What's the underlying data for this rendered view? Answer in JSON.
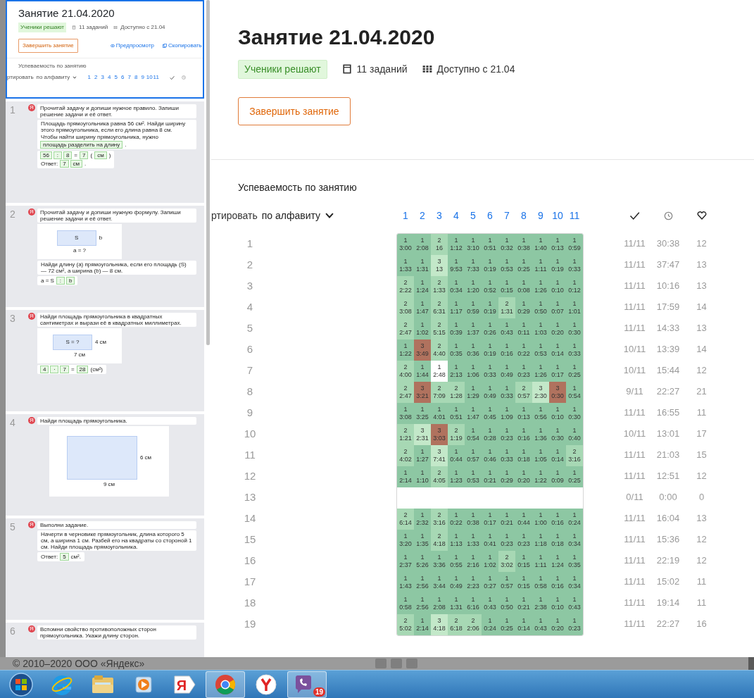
{
  "sidebar": {
    "preview": {
      "selected": true,
      "title": "Занятие 21.04.2020",
      "status": "Ученики решают",
      "tasks": "11 заданий",
      "available": "Доступно с 21.04",
      "finish_button": "Завершить занятие",
      "preview_link": "Предпросмотр",
      "copy_link": "Скопировать",
      "section": "Успеваемость по занятию",
      "sort_label": "ртировать",
      "sort_value": "по алфавиту",
      "columns": [
        "1",
        "2",
        "3",
        "4",
        "5",
        "6",
        "7",
        "8",
        "9",
        "10",
        "11"
      ]
    },
    "slides": [
      {
        "number": "1",
        "items": [
          {
            "kind": "instruction",
            "mark": "Я",
            "text": "Прочитай задачу и допиши нужное правило. Запиши решение задачи и её ответ."
          },
          {
            "kind": "card",
            "lines": [
              [
                {
                  "kind": "label",
                  "text": "Площадь прямоугольника равна 56 см². Найди ширину этого прямоугольника, если его длина равна 8 см."
                }
              ],
              [
                {
                  "kind": "label",
                  "text": "Чтобы найти ширину прямоугольника, нужно"
                }
              ],
              [
                {
                  "kind": "input",
                  "text": "площадь разделить на длину"
                },
                {
                  "kind": "label",
                  "text": "."
                }
              ]
            ]
          },
          {
            "kind": "card",
            "lines": [
              [
                {
                  "kind": "input",
                  "text": "56"
                },
                {
                  "kind": "input",
                  "text": ":"
                },
                {
                  "kind": "input",
                  "text": "8"
                },
                {
                  "kind": "label",
                  "text": "="
                },
                {
                  "kind": "input",
                  "text": "7"
                },
                {
                  "kind": "label",
                  "text": "("
                },
                {
                  "kind": "input",
                  "text": "см"
                },
                {
                  "kind": "label",
                  "text": ")"
                }
              ],
              [
                {
                  "kind": "label",
                  "text": "Ответ:"
                },
                {
                  "kind": "input",
                  "text": "7"
                },
                {
                  "kind": "input",
                  "text": "см"
                },
                {
                  "kind": "label",
                  "text": "."
                }
              ]
            ]
          }
        ]
      },
      {
        "number": "2",
        "items": [
          {
            "kind": "instruction",
            "mark": "Я",
            "text": "Прочитай задачу и допиши нужную формулу. Запиши решение задачи и её ответ."
          },
          {
            "kind": "figure",
            "inside": "S",
            "side": "b",
            "bottom": "a = ?"
          },
          {
            "kind": "card",
            "lines": [
              [
                {
                  "kind": "label",
                  "text": "Найди длину (a) прямоугольника, если его площадь (S) — 72 см², а ширина (b) — 8 см."
                }
              ]
            ]
          },
          {
            "kind": "card",
            "lines": [
              [
                {
                  "kind": "label",
                  "text": "a = S"
                },
                {
                  "kind": "input",
                  "text": ":"
                },
                {
                  "kind": "input",
                  "text": "b"
                }
              ]
            ]
          }
        ]
      },
      {
        "number": "3",
        "items": [
          {
            "kind": "instruction",
            "mark": "Я",
            "text": "Найди площадь прямоугольника в квадратных сантиметрах и вырази её в квадратных миллиметрах."
          },
          {
            "kind": "figure",
            "inside": "S = ?",
            "side": "4 см",
            "bottom": "7 см"
          },
          {
            "kind": "card",
            "lines": [
              [
                {
                  "kind": "input",
                  "text": "4"
                },
                {
                  "kind": "input",
                  "text": "·"
                },
                {
                  "kind": "input",
                  "text": "7"
                },
                {
                  "kind": "label",
                  "text": "="
                },
                {
                  "kind": "input",
                  "text": "28"
                },
                {
                  "kind": "label",
                  "text": "(см²)"
                }
              ]
            ]
          }
        ]
      },
      {
        "number": "4",
        "items": [
          {
            "kind": "instruction",
            "mark": "Я",
            "text": "Найди площадь прямоугольника."
          },
          {
            "kind": "figure-large",
            "side": "6 см",
            "bottom": "9 см"
          }
        ]
      },
      {
        "number": "5",
        "items": [
          {
            "kind": "instruction",
            "mark": "Я",
            "text": "Выполни задание."
          },
          {
            "kind": "card",
            "lines": [
              [
                {
                  "kind": "label",
                  "text": "Начерти в черновике прямоугольник, длина которого 5 см, а ширина 1 см. Разбей его на квадраты со стороной 1 см. Найди площадь прямоугольника."
                }
              ]
            ]
          },
          {
            "kind": "card",
            "lines": [
              [
                {
                  "kind": "label",
                  "text": "Ответ:"
                },
                {
                  "kind": "input",
                  "text": "5"
                },
                {
                  "kind": "label",
                  "text": "см²."
                }
              ]
            ]
          }
        ]
      },
      {
        "number": "6",
        "items": [
          {
            "kind": "instruction",
            "mark": "Я",
            "text": "Вспомни свойство противоположных сторон прямоугольника. Укажи длину сторон."
          }
        ]
      }
    ]
  },
  "lesson": {
    "title": "Занятие 21.04.2020",
    "status": "Ученики решают",
    "tasks": "11 заданий",
    "available": "Доступно с 21.04",
    "finish_button": "Завершить занятие"
  },
  "progress": {
    "title": "Успеваемость по занятию",
    "sort_label": "ртировать",
    "sort_value": "по алфавиту",
    "columns": [
      "1",
      "2",
      "3",
      "4",
      "5",
      "6",
      "7",
      "8",
      "9",
      "10",
      "11"
    ],
    "rows": [
      {
        "number": "1",
        "cells": [
          {
            "tries": "1",
            "time": "3:00",
            "kind": "g1"
          },
          {
            "tries": "1",
            "time": "2:08",
            "kind": "g1"
          },
          {
            "tries": "2",
            "time": "16",
            "kind": "g2"
          },
          {
            "tries": "1",
            "time": "1:12",
            "kind": "g1"
          },
          {
            "tries": "1",
            "time": "3:10",
            "kind": "g1"
          },
          {
            "tries": "1",
            "time": "0:51",
            "kind": "g1"
          },
          {
            "tries": "1",
            "time": "0:32",
            "kind": "g1"
          },
          {
            "tries": "1",
            "time": "0:38",
            "kind": "g1"
          },
          {
            "tries": "1",
            "time": "1:40",
            "kind": "g1"
          },
          {
            "tries": "1",
            "time": "0:13",
            "kind": "g1"
          },
          {
            "tries": "1",
            "time": "0:59",
            "kind": "g1"
          }
        ],
        "solved": "11/11",
        "time": "30:38",
        "score": "12"
      },
      {
        "number": "2",
        "cells": [
          {
            "tries": "1",
            "time": "1:33",
            "kind": "g1"
          },
          {
            "tries": "1",
            "time": "1:31",
            "kind": "g1"
          },
          {
            "tries": "3",
            "time": "13",
            "kind": "g3"
          },
          {
            "tries": "1",
            "time": "9:53",
            "kind": "g1"
          },
          {
            "tries": "1",
            "time": "7:33",
            "kind": "g1"
          },
          {
            "tries": "1",
            "time": "0:19",
            "kind": "g1"
          },
          {
            "tries": "1",
            "time": "0:53",
            "kind": "g1"
          },
          {
            "tries": "1",
            "time": "0:25",
            "kind": "g1"
          },
          {
            "tries": "1",
            "time": "1:11",
            "kind": "g1"
          },
          {
            "tries": "1",
            "time": "0:19",
            "kind": "g1"
          },
          {
            "tries": "1",
            "time": "0:33",
            "kind": "g1"
          }
        ],
        "solved": "11/11",
        "time": "37:47",
        "score": "13"
      },
      {
        "number": "3",
        "cells": [
          {
            "tries": "2",
            "time": "2:22",
            "kind": "g2"
          },
          {
            "tries": "1",
            "time": "1:24",
            "kind": "g1"
          },
          {
            "tries": "2",
            "time": "1:33",
            "kind": "g2"
          },
          {
            "tries": "1",
            "time": "0:34",
            "kind": "g1"
          },
          {
            "tries": "1",
            "time": "1:20",
            "kind": "g1"
          },
          {
            "tries": "1",
            "time": "0:52",
            "kind": "g1"
          },
          {
            "tries": "1",
            "time": "0:15",
            "kind": "g1"
          },
          {
            "tries": "1",
            "time": "0:08",
            "kind": "g1"
          },
          {
            "tries": "1",
            "time": "1:26",
            "kind": "g1"
          },
          {
            "tries": "1",
            "time": "0:10",
            "kind": "g1"
          },
          {
            "tries": "1",
            "time": "0:12",
            "kind": "g1"
          }
        ],
        "solved": "11/11",
        "time": "10:16",
        "score": "13"
      },
      {
        "number": "4",
        "cells": [
          {
            "tries": "2",
            "time": "3:08",
            "kind": "g2"
          },
          {
            "tries": "1",
            "time": "1:47",
            "kind": "g1"
          },
          {
            "tries": "2",
            "time": "6:31",
            "kind": "g2"
          },
          {
            "tries": "1",
            "time": "1:17",
            "kind": "g1"
          },
          {
            "tries": "1",
            "time": "0:59",
            "kind": "g1"
          },
          {
            "tries": "1",
            "time": "0:19",
            "kind": "g1"
          },
          {
            "tries": "2",
            "time": "1:31",
            "kind": "g2"
          },
          {
            "tries": "1",
            "time": "0:29",
            "kind": "g1"
          },
          {
            "tries": "1",
            "time": "0:50",
            "kind": "g1"
          },
          {
            "tries": "1",
            "time": "0:07",
            "kind": "g1"
          },
          {
            "tries": "1",
            "time": "1:01",
            "kind": "g1"
          }
        ],
        "solved": "11/11",
        "time": "17:59",
        "score": "14"
      },
      {
        "number": "5",
        "cells": [
          {
            "tries": "2",
            "time": "2:47",
            "kind": "g2"
          },
          {
            "tries": "1",
            "time": "1:02",
            "kind": "g1"
          },
          {
            "tries": "2",
            "time": "5:15",
            "kind": "g2"
          },
          {
            "tries": "1",
            "time": "0:39",
            "kind": "g1"
          },
          {
            "tries": "1",
            "time": "1:37",
            "kind": "g1"
          },
          {
            "tries": "1",
            "time": "0:26",
            "kind": "g1"
          },
          {
            "tries": "1",
            "time": "0:43",
            "kind": "g1"
          },
          {
            "tries": "1",
            "time": "0:11",
            "kind": "g1"
          },
          {
            "tries": "1",
            "time": "1:03",
            "kind": "g1"
          },
          {
            "tries": "1",
            "time": "0:20",
            "kind": "g1"
          },
          {
            "tries": "1",
            "time": "0:30",
            "kind": "g1"
          }
        ],
        "solved": "11/11",
        "time": "14:33",
        "score": "13"
      },
      {
        "number": "6",
        "cells": [
          {
            "tries": "1",
            "time": "1:22",
            "kind": "g1"
          },
          {
            "tries": "3",
            "time": "3:49",
            "kind": "failed"
          },
          {
            "tries": "2",
            "time": "4:40",
            "kind": "g2"
          },
          {
            "tries": "1",
            "time": "0:35",
            "kind": "g1"
          },
          {
            "tries": "1",
            "time": "0:36",
            "kind": "g1"
          },
          {
            "tries": "1",
            "time": "0:19",
            "kind": "g1"
          },
          {
            "tries": "1",
            "time": "0:16",
            "kind": "g1"
          },
          {
            "tries": "1",
            "time": "0:22",
            "kind": "g1"
          },
          {
            "tries": "1",
            "time": "0:53",
            "kind": "g1"
          },
          {
            "tries": "1",
            "time": "0:14",
            "kind": "g1"
          },
          {
            "tries": "1",
            "time": "0:33",
            "kind": "g1"
          }
        ],
        "solved": "10/11",
        "time": "13:39",
        "score": "14"
      },
      {
        "number": "7",
        "cells": [
          {
            "tries": "2",
            "time": "4:00",
            "kind": "g2"
          },
          {
            "tries": "1",
            "time": "1:44",
            "kind": "g1"
          },
          {
            "tries": "1",
            "time": "2:48",
            "kind": "open"
          },
          {
            "tries": "1",
            "time": "2:13",
            "kind": "g1"
          },
          {
            "tries": "1",
            "time": "1:06",
            "kind": "g1"
          },
          {
            "tries": "1",
            "time": "0:33",
            "kind": "g1"
          },
          {
            "tries": "1",
            "time": "0:49",
            "kind": "g1"
          },
          {
            "tries": "1",
            "time": "0:23",
            "kind": "g1"
          },
          {
            "tries": "1",
            "time": "1:26",
            "kind": "g1"
          },
          {
            "tries": "1",
            "time": "0:17",
            "kind": "g1"
          },
          {
            "tries": "1",
            "time": "0:25",
            "kind": "g1"
          }
        ],
        "solved": "10/11",
        "time": "15:44",
        "score": "12"
      },
      {
        "number": "8",
        "cells": [
          {
            "tries": "2",
            "time": "2:47",
            "kind": "g2"
          },
          {
            "tries": "3",
            "time": "3:21",
            "kind": "failed"
          },
          {
            "tries": "2",
            "time": "7:09",
            "kind": "g2"
          },
          {
            "tries": "2",
            "time": "1:28",
            "kind": "g2"
          },
          {
            "tries": "1",
            "time": "1:29",
            "kind": "g1"
          },
          {
            "tries": "1",
            "time": "0:49",
            "kind": "g1"
          },
          {
            "tries": "1",
            "time": "0:33",
            "kind": "g1"
          },
          {
            "tries": "2",
            "time": "0:57",
            "kind": "g2"
          },
          {
            "tries": "3",
            "time": "2:30",
            "kind": "g3"
          },
          {
            "tries": "3",
            "time": "0:30",
            "kind": "failed"
          },
          {
            "tries": "1",
            "time": "0:54",
            "kind": "g1"
          }
        ],
        "solved": "9/11",
        "time": "22:27",
        "score": "21"
      },
      {
        "number": "9",
        "cells": [
          {
            "tries": "1",
            "time": "3:08",
            "kind": "g1"
          },
          {
            "tries": "1",
            "time": "3:25",
            "kind": "g1"
          },
          {
            "tries": "1",
            "time": "4:01",
            "kind": "g1"
          },
          {
            "tries": "1",
            "time": "0:51",
            "kind": "g1"
          },
          {
            "tries": "1",
            "time": "1:47",
            "kind": "g1"
          },
          {
            "tries": "1",
            "time": "0:45",
            "kind": "g1"
          },
          {
            "tries": "1",
            "time": "1:09",
            "kind": "g1"
          },
          {
            "tries": "1",
            "time": "0:13",
            "kind": "g1"
          },
          {
            "tries": "1",
            "time": "0:56",
            "kind": "g1"
          },
          {
            "tries": "1",
            "time": "0:10",
            "kind": "g1"
          },
          {
            "tries": "1",
            "time": "0:30",
            "kind": "g1"
          }
        ],
        "solved": "11/11",
        "time": "16:55",
        "score": "11"
      },
      {
        "number": "10",
        "cells": [
          {
            "tries": "2",
            "time": "1:21",
            "kind": "g2"
          },
          {
            "tries": "3",
            "time": "2:31",
            "kind": "g3"
          },
          {
            "tries": "3",
            "time": "3:03",
            "kind": "failed"
          },
          {
            "tries": "2",
            "time": "1:19",
            "kind": "g2"
          },
          {
            "tries": "1",
            "time": "0:54",
            "kind": "g1"
          },
          {
            "tries": "1",
            "time": "0:28",
            "kind": "g1"
          },
          {
            "tries": "1",
            "time": "0:23",
            "kind": "g1"
          },
          {
            "tries": "1",
            "time": "0:16",
            "kind": "g1"
          },
          {
            "tries": "1",
            "time": "1:36",
            "kind": "g1"
          },
          {
            "tries": "1",
            "time": "0:30",
            "kind": "g1"
          },
          {
            "tries": "1",
            "time": "0:40",
            "kind": "g1"
          }
        ],
        "solved": "10/11",
        "time": "13:01",
        "score": "17"
      },
      {
        "number": "11",
        "cells": [
          {
            "tries": "2",
            "time": "4:02",
            "kind": "g2"
          },
          {
            "tries": "1",
            "time": "1:27",
            "kind": "g1"
          },
          {
            "tries": "3",
            "time": "7:41",
            "kind": "g3"
          },
          {
            "tries": "1",
            "time": "0:44",
            "kind": "g1"
          },
          {
            "tries": "1",
            "time": "0:57",
            "kind": "g1"
          },
          {
            "tries": "1",
            "time": "0:46",
            "kind": "g1"
          },
          {
            "tries": "1",
            "time": "0:33",
            "kind": "g1"
          },
          {
            "tries": "1",
            "time": "0:18",
            "kind": "g1"
          },
          {
            "tries": "1",
            "time": "1:05",
            "kind": "g1"
          },
          {
            "tries": "1",
            "time": "0:14",
            "kind": "g1"
          },
          {
            "tries": "2",
            "time": "3:16",
            "kind": "g2"
          }
        ],
        "solved": "11/11",
        "time": "21:03",
        "score": "15"
      },
      {
        "number": "12",
        "cells": [
          {
            "tries": "1",
            "time": "2:14",
            "kind": "g1"
          },
          {
            "tries": "1",
            "time": "1:10",
            "kind": "g1"
          },
          {
            "tries": "2",
            "time": "4:05",
            "kind": "g2"
          },
          {
            "tries": "1",
            "time": "1:23",
            "kind": "g1"
          },
          {
            "tries": "1",
            "time": "0:53",
            "kind": "g1"
          },
          {
            "tries": "1",
            "time": "0:21",
            "kind": "g1"
          },
          {
            "tries": "1",
            "time": "0:29",
            "kind": "g1"
          },
          {
            "tries": "1",
            "time": "0:20",
            "kind": "g1"
          },
          {
            "tries": "1",
            "time": "1:22",
            "kind": "g1"
          },
          {
            "tries": "1",
            "time": "0:09",
            "kind": "g1"
          },
          {
            "tries": "1",
            "time": "0:25",
            "kind": "g1"
          }
        ],
        "solved": "11/11",
        "time": "12:51",
        "score": "12"
      },
      {
        "number": "13",
        "solved": "0/11",
        "time": "0:00",
        "score": "0"
      },
      {
        "number": "14",
        "cells": [
          {
            "tries": "2",
            "time": "6:14",
            "kind": "g2"
          },
          {
            "tries": "1",
            "time": "2:32",
            "kind": "g1"
          },
          {
            "tries": "2",
            "time": "3:16",
            "kind": "g2"
          },
          {
            "tries": "1",
            "time": "0:22",
            "kind": "g1"
          },
          {
            "tries": "1",
            "time": "0:38",
            "kind": "g1"
          },
          {
            "tries": "1",
            "time": "0:17",
            "kind": "g1"
          },
          {
            "tries": "1",
            "time": "0:21",
            "kind": "g1"
          },
          {
            "tries": "1",
            "time": "0:44",
            "kind": "g1"
          },
          {
            "tries": "1",
            "time": "1:00",
            "kind": "g1"
          },
          {
            "tries": "1",
            "time": "0:16",
            "kind": "g1"
          },
          {
            "tries": "1",
            "time": "0:24",
            "kind": "g1"
          }
        ],
        "solved": "11/11",
        "time": "16:04",
        "score": "13"
      },
      {
        "number": "15",
        "cells": [
          {
            "tries": "1",
            "time": "3:20",
            "kind": "g1"
          },
          {
            "tries": "1",
            "time": "1:35",
            "kind": "g1"
          },
          {
            "tries": "2",
            "time": "4:18",
            "kind": "g2"
          },
          {
            "tries": "1",
            "time": "1:13",
            "kind": "g1"
          },
          {
            "tries": "1",
            "time": "1:33",
            "kind": "g1"
          },
          {
            "tries": "1",
            "time": "0:41",
            "kind": "g1"
          },
          {
            "tries": "1",
            "time": "0:23",
            "kind": "g1"
          },
          {
            "tries": "1",
            "time": "0:23",
            "kind": "g1"
          },
          {
            "tries": "1",
            "time": "1:18",
            "kind": "g1"
          },
          {
            "tries": "1",
            "time": "0:18",
            "kind": "g1"
          },
          {
            "tries": "1",
            "time": "0:34",
            "kind": "g1"
          }
        ],
        "solved": "11/11",
        "time": "15:36",
        "score": "12"
      },
      {
        "number": "16",
        "cells": [
          {
            "tries": "1",
            "time": "2:37",
            "kind": "g1"
          },
          {
            "tries": "1",
            "time": "5:26",
            "kind": "g1"
          },
          {
            "tries": "1",
            "time": "3:36",
            "kind": "g1"
          },
          {
            "tries": "1",
            "time": "0:55",
            "kind": "g1"
          },
          {
            "tries": "1",
            "time": "2:16",
            "kind": "g1"
          },
          {
            "tries": "1",
            "time": "1:02",
            "kind": "g1"
          },
          {
            "tries": "2",
            "time": "3:02",
            "kind": "g2"
          },
          {
            "tries": "1",
            "time": "0:15",
            "kind": "g1"
          },
          {
            "tries": "1",
            "time": "1:11",
            "kind": "g1"
          },
          {
            "tries": "1",
            "time": "1:24",
            "kind": "g1"
          },
          {
            "tries": "1",
            "time": "0:35",
            "kind": "g1"
          }
        ],
        "solved": "11/11",
        "time": "22:19",
        "score": "12"
      },
      {
        "number": "17",
        "cells": [
          {
            "tries": "1",
            "time": "1:43",
            "kind": "g1"
          },
          {
            "tries": "1",
            "time": "2:56",
            "kind": "g1"
          },
          {
            "tries": "1",
            "time": "3:44",
            "kind": "g1"
          },
          {
            "tries": "1",
            "time": "0:49",
            "kind": "g1"
          },
          {
            "tries": "1",
            "time": "2:23",
            "kind": "g1"
          },
          {
            "tries": "1",
            "time": "0:27",
            "kind": "g1"
          },
          {
            "tries": "1",
            "time": "0:57",
            "kind": "g1"
          },
          {
            "tries": "1",
            "time": "0:15",
            "kind": "g1"
          },
          {
            "tries": "1",
            "time": "0:58",
            "kind": "g1"
          },
          {
            "tries": "1",
            "time": "0:16",
            "kind": "g1"
          },
          {
            "tries": "1",
            "time": "0:34",
            "kind": "g1"
          }
        ],
        "solved": "11/11",
        "time": "15:02",
        "score": "11"
      },
      {
        "number": "18",
        "cells": [
          {
            "tries": "1",
            "time": "0:58",
            "kind": "g1"
          },
          {
            "tries": "1",
            "time": "2:56",
            "kind": "g1"
          },
          {
            "tries": "1",
            "time": "2:08",
            "kind": "g1"
          },
          {
            "tries": "1",
            "time": "1:31",
            "kind": "g1"
          },
          {
            "tries": "1",
            "time": "6:16",
            "kind": "g1"
          },
          {
            "tries": "1",
            "time": "0:43",
            "kind": "g1"
          },
          {
            "tries": "1",
            "time": "0:50",
            "kind": "g1"
          },
          {
            "tries": "1",
            "time": "0:21",
            "kind": "g1"
          },
          {
            "tries": "1",
            "time": "2:38",
            "kind": "g1"
          },
          {
            "tries": "1",
            "time": "0:10",
            "kind": "g1"
          },
          {
            "tries": "1",
            "time": "0:43",
            "kind": "g1"
          }
        ],
        "solved": "11/11",
        "time": "19:14",
        "score": "11"
      },
      {
        "number": "19",
        "cells": [
          {
            "tries": "2",
            "time": "5:02",
            "kind": "g2"
          },
          {
            "tries": "1",
            "time": "2:14",
            "kind": "g1"
          },
          {
            "tries": "3",
            "time": "4:18",
            "kind": "g3"
          },
          {
            "tries": "2",
            "time": "6:18",
            "kind": "g2"
          },
          {
            "tries": "2",
            "time": "2:06",
            "kind": "g2"
          },
          {
            "tries": "1",
            "time": "0:24",
            "kind": "g1"
          },
          {
            "tries": "1",
            "time": "0:25",
            "kind": "g1"
          },
          {
            "tries": "1",
            "time": "0:14",
            "kind": "g1"
          },
          {
            "tries": "1",
            "time": "0:43",
            "kind": "g1"
          },
          {
            "tries": "1",
            "time": "0:20",
            "kind": "g1"
          },
          {
            "tries": "1",
            "time": "0:23",
            "kind": "g1"
          }
        ],
        "solved": "11/11",
        "time": "22:27",
        "score": "16"
      }
    ]
  },
  "footer": {
    "copyright": "© 2010–2020 ООО «Яндекс»"
  },
  "taskbar": [
    {
      "kind": "start",
      "active": false
    },
    {
      "kind": "ie",
      "active": false
    },
    {
      "kind": "folder",
      "active": false
    },
    {
      "kind": "media",
      "active": false
    },
    {
      "kind": "letter-tag",
      "active": false,
      "letter": "Я"
    },
    {
      "kind": "chrome",
      "active": true
    },
    {
      "kind": "y-browser",
      "active": false
    },
    {
      "kind": "viber",
      "active": true,
      "badge": "19"
    }
  ]
}
